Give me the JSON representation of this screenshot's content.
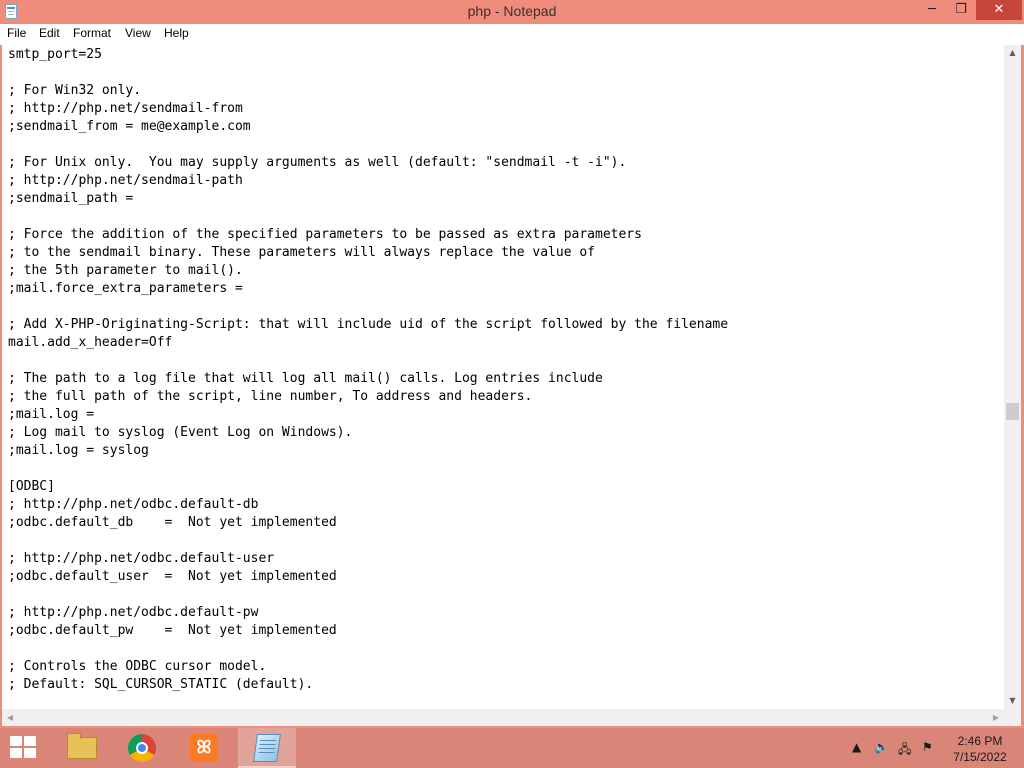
{
  "window": {
    "title": "php - Notepad",
    "controls": {
      "minimize": "─",
      "maximize": "❐",
      "close": "✕"
    }
  },
  "menu": {
    "items": [
      "File",
      "Edit",
      "Format",
      "View",
      "Help"
    ]
  },
  "editor": {
    "text": "smtp_port=25\n\n; For Win32 only.\n; http://php.net/sendmail-from\n;sendmail_from = me@example.com\n\n; For Unix only.  You may supply arguments as well (default: \"sendmail -t -i\").\n; http://php.net/sendmail-path\n;sendmail_path =\n\n; Force the addition of the specified parameters to be passed as extra parameters\n; to the sendmail binary. These parameters will always replace the value of\n; the 5th parameter to mail().\n;mail.force_extra_parameters =\n\n; Add X-PHP-Originating-Script: that will include uid of the script followed by the filename\nmail.add_x_header=Off\n\n; The path to a log file that will log all mail() calls. Log entries include\n; the full path of the script, line number, To address and headers.\n;mail.log =\n; Log mail to syslog (Event Log on Windows).\n;mail.log = syslog\n\n[ODBC]\n; http://php.net/odbc.default-db\n;odbc.default_db    =  Not yet implemented\n\n; http://php.net/odbc.default-user\n;odbc.default_user  =  Not yet implemented\n\n; http://php.net/odbc.default-pw\n;odbc.default_pw    =  Not yet implemented\n\n; Controls the ODBC cursor model.\n; Default: SQL_CURSOR_STATIC (default)."
  },
  "scrollbars": {
    "up": "▲",
    "down": "▼",
    "left": "◀",
    "right": "▶"
  },
  "taskbar": {
    "apps": [
      "file-explorer",
      "google-chrome",
      "xampp-control-panel",
      "notepad"
    ],
    "xampp_glyph": "ꕤ",
    "tray": {
      "chevron": "▲",
      "volume": "🔈",
      "network": "🖧",
      "flag": "⚑"
    },
    "clock": {
      "time": "2:46 PM",
      "date": "7/15/2022"
    }
  },
  "colors": {
    "accent": "#f08c7c",
    "taskbar": "#d98679",
    "close": "#c7463b"
  }
}
